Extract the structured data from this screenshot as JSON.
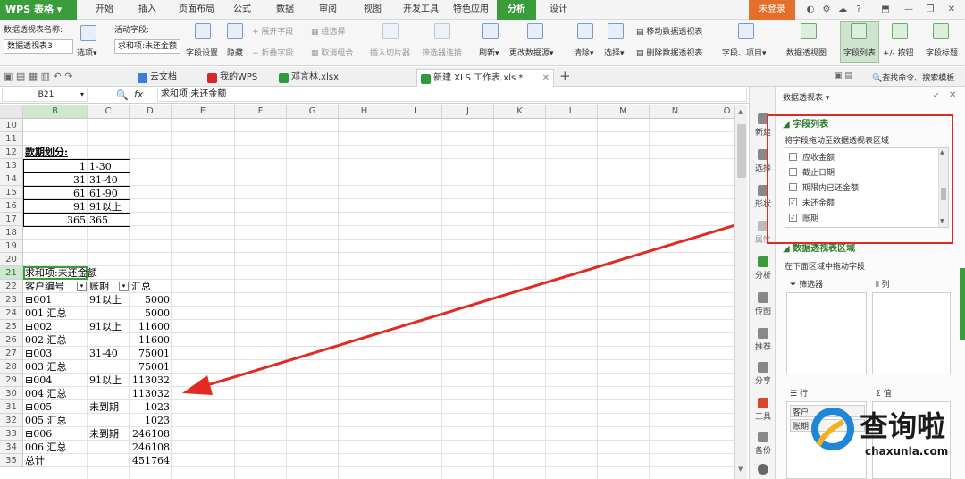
{
  "app": {
    "logo": "WPS 表格",
    "login": "未登录"
  },
  "menu": [
    "开始",
    "插入",
    "页面布局",
    "公式",
    "数据",
    "审阅",
    "视图",
    "开发工具",
    "特色应用",
    "分析",
    "设计"
  ],
  "ribbon": {
    "pivot_name_label": "数据透视表名称:",
    "pivot_name_value": "数据透视表3",
    "options": "选项",
    "active_field_label": "活动字段:",
    "active_field_value": "求和项:未还金额",
    "field_settings": "字段设置",
    "hide": "隐藏",
    "expand_field": "展开字段",
    "collapse_field": "折叠字段",
    "group_select": "组选择",
    "ungroup": "取消组合",
    "insert_slicer": "插入切片器",
    "filter_connections": "筛选器连接",
    "refresh": "刷新",
    "change_source": "更改数据源",
    "clear": "清除",
    "select": "选择",
    "move_pivot": "移动数据透视表",
    "delete_pivot": "删除数据透视表",
    "fields_items": "字段、项目",
    "pivot_chart": "数据透视图",
    "field_list": "字段列表",
    "pm_buttons": "+/- 按钮",
    "field_headers": "字段标题"
  },
  "tabs": [
    {
      "label": "云文档"
    },
    {
      "label": "我的WPS"
    },
    {
      "label": "邓言林.xlsx"
    },
    {
      "label": "新建 XLS 工作表.xls *"
    }
  ],
  "right_tools": {
    "search": "查找命令、搜索模板"
  },
  "formula": {
    "cell_ref": "B21",
    "fx": "fx",
    "content": "求和项:未还金额"
  },
  "columns": [
    "B",
    "C",
    "D",
    "E",
    "F",
    "G",
    "H",
    "I",
    "J",
    "K",
    "L",
    "M",
    "N",
    "O"
  ],
  "rows": [
    10,
    11,
    12,
    13,
    14,
    15,
    16,
    17,
    18,
    19,
    20,
    21,
    22,
    23,
    24,
    25,
    26,
    27,
    28,
    29,
    30,
    31,
    32,
    33,
    34,
    35
  ],
  "sheet": {
    "period_title": "款期划分:",
    "periods": [
      {
        "start": "1",
        "label": "1-30"
      },
      {
        "start": "31",
        "label": "31-40"
      },
      {
        "start": "61",
        "label": "61-90"
      },
      {
        "start": "91",
        "label": "91以上"
      },
      {
        "start": "365",
        "label": "365"
      }
    ],
    "pivot_title": "求和项:未还金额",
    "hdr_customer": "客户编号",
    "hdr_period": "账期",
    "hdr_total": "汇总",
    "pivot_rows": [
      {
        "b": "⊟001",
        "c": "91以上",
        "d": "5000"
      },
      {
        "b": "001 汇总",
        "c": "",
        "d": "5000"
      },
      {
        "b": "⊟002",
        "c": "91以上",
        "d": "11600"
      },
      {
        "b": "002 汇总",
        "c": "",
        "d": "11600"
      },
      {
        "b": "⊟003",
        "c": "31-40",
        "d": "75001"
      },
      {
        "b": "003 汇总",
        "c": "",
        "d": "75001"
      },
      {
        "b": "⊟004",
        "c": "91以上",
        "d": "113032"
      },
      {
        "b": "004 汇总",
        "c": "",
        "d": "113032"
      },
      {
        "b": "⊟005",
        "c": "未到期",
        "d": "1023"
      },
      {
        "b": "005 汇总",
        "c": "",
        "d": "1023"
      },
      {
        "b": "⊟006",
        "c": "未到期",
        "d": "246108"
      },
      {
        "b": "006 汇总",
        "c": "",
        "d": "246108"
      },
      {
        "b": "总计",
        "c": "",
        "d": "451764"
      }
    ]
  },
  "side_tools": [
    "新建",
    "选择",
    "形状",
    "属性",
    "分析",
    "传图",
    "推荐",
    "分享",
    "工具",
    "备份"
  ],
  "pane": {
    "title": "数据透视表",
    "field_list_heading": "字段列表",
    "drag_hint": "将字段拖动至数据透视表区域",
    "fields": [
      {
        "name": "应收金额",
        "checked": false
      },
      {
        "name": "截止日期",
        "checked": false
      },
      {
        "name": "期限内已还金额",
        "checked": false
      },
      {
        "name": "未还金额",
        "checked": true
      },
      {
        "name": "账期",
        "checked": true
      }
    ],
    "areas_heading": "数据透视表区域",
    "areas_hint": "在下面区域中拖动字段",
    "filter": "筛选器",
    "column": "列",
    "row": "行",
    "value": "值",
    "row_items": [
      "客户",
      "账期"
    ]
  },
  "watermark": {
    "text": "查询啦",
    "url": "chaxunla.com"
  },
  "colors": {
    "accent": "#3a9c3a",
    "annotation": "#e02a22"
  }
}
